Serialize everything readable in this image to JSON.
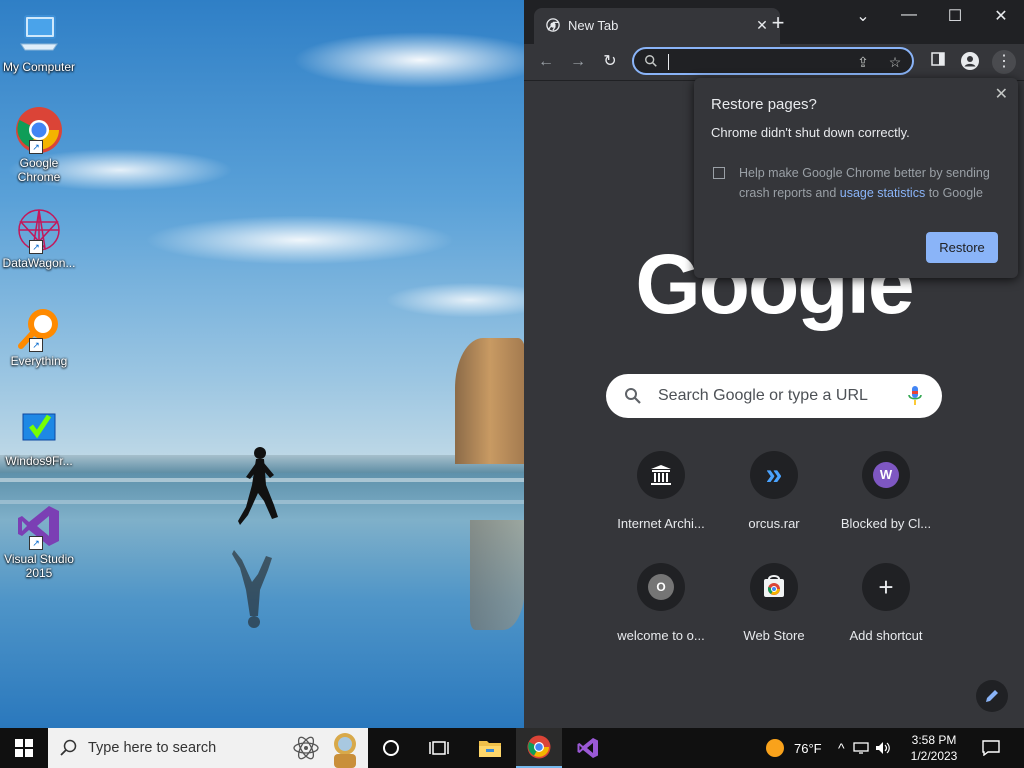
{
  "desktop": {
    "icons": [
      {
        "label": "My Computer"
      },
      {
        "label": "Google Chrome"
      },
      {
        "label": "DataWagon..."
      },
      {
        "label": "Everything"
      },
      {
        "label": "Windos9Fr..."
      },
      {
        "label": "Visual Studio 2015"
      }
    ]
  },
  "browser": {
    "tab_title": "New Tab",
    "window_controls": {
      "dropdown": "⌄",
      "minimize": "—",
      "maximize": "☐",
      "close": "✕"
    },
    "omnibox_value": "",
    "logo_text": "Google",
    "search_placeholder": "Search Google or type a URL",
    "shortcuts": [
      {
        "label": "Internet Archi...",
        "glyph": "🏛",
        "icon": "museum-icon"
      },
      {
        "label": "orcus.rar",
        "glyph": "»",
        "icon": "double-chevron-icon"
      },
      {
        "label": "Blocked by Cl...",
        "glyph": "W",
        "icon": "letter-w-icon"
      },
      {
        "label": "welcome to o...",
        "glyph": "O",
        "icon": "letter-o-icon"
      },
      {
        "label": "Web Store",
        "glyph": "",
        "icon": "web-store-icon"
      },
      {
        "label": "Add shortcut",
        "glyph": "+",
        "icon": "plus-icon"
      }
    ],
    "restore_popup": {
      "title": "Restore pages?",
      "subtitle": "Chrome didn't shut down correctly.",
      "checkbox_text_before": "Help make Google Chrome better by sending crash reports and ",
      "checkbox_link": "usage statistics",
      "checkbox_text_after": " to Google",
      "button_label": "Restore",
      "checked": false
    }
  },
  "taskbar": {
    "search_placeholder": "Type here to search",
    "weather": "76°F",
    "time": "3:58 PM",
    "date": "1/2/2023"
  },
  "colors": {
    "accent": "#8ab4f8",
    "chrome_bg": "#35363a",
    "titlebar": "#202124",
    "taskbar": "#101010"
  }
}
